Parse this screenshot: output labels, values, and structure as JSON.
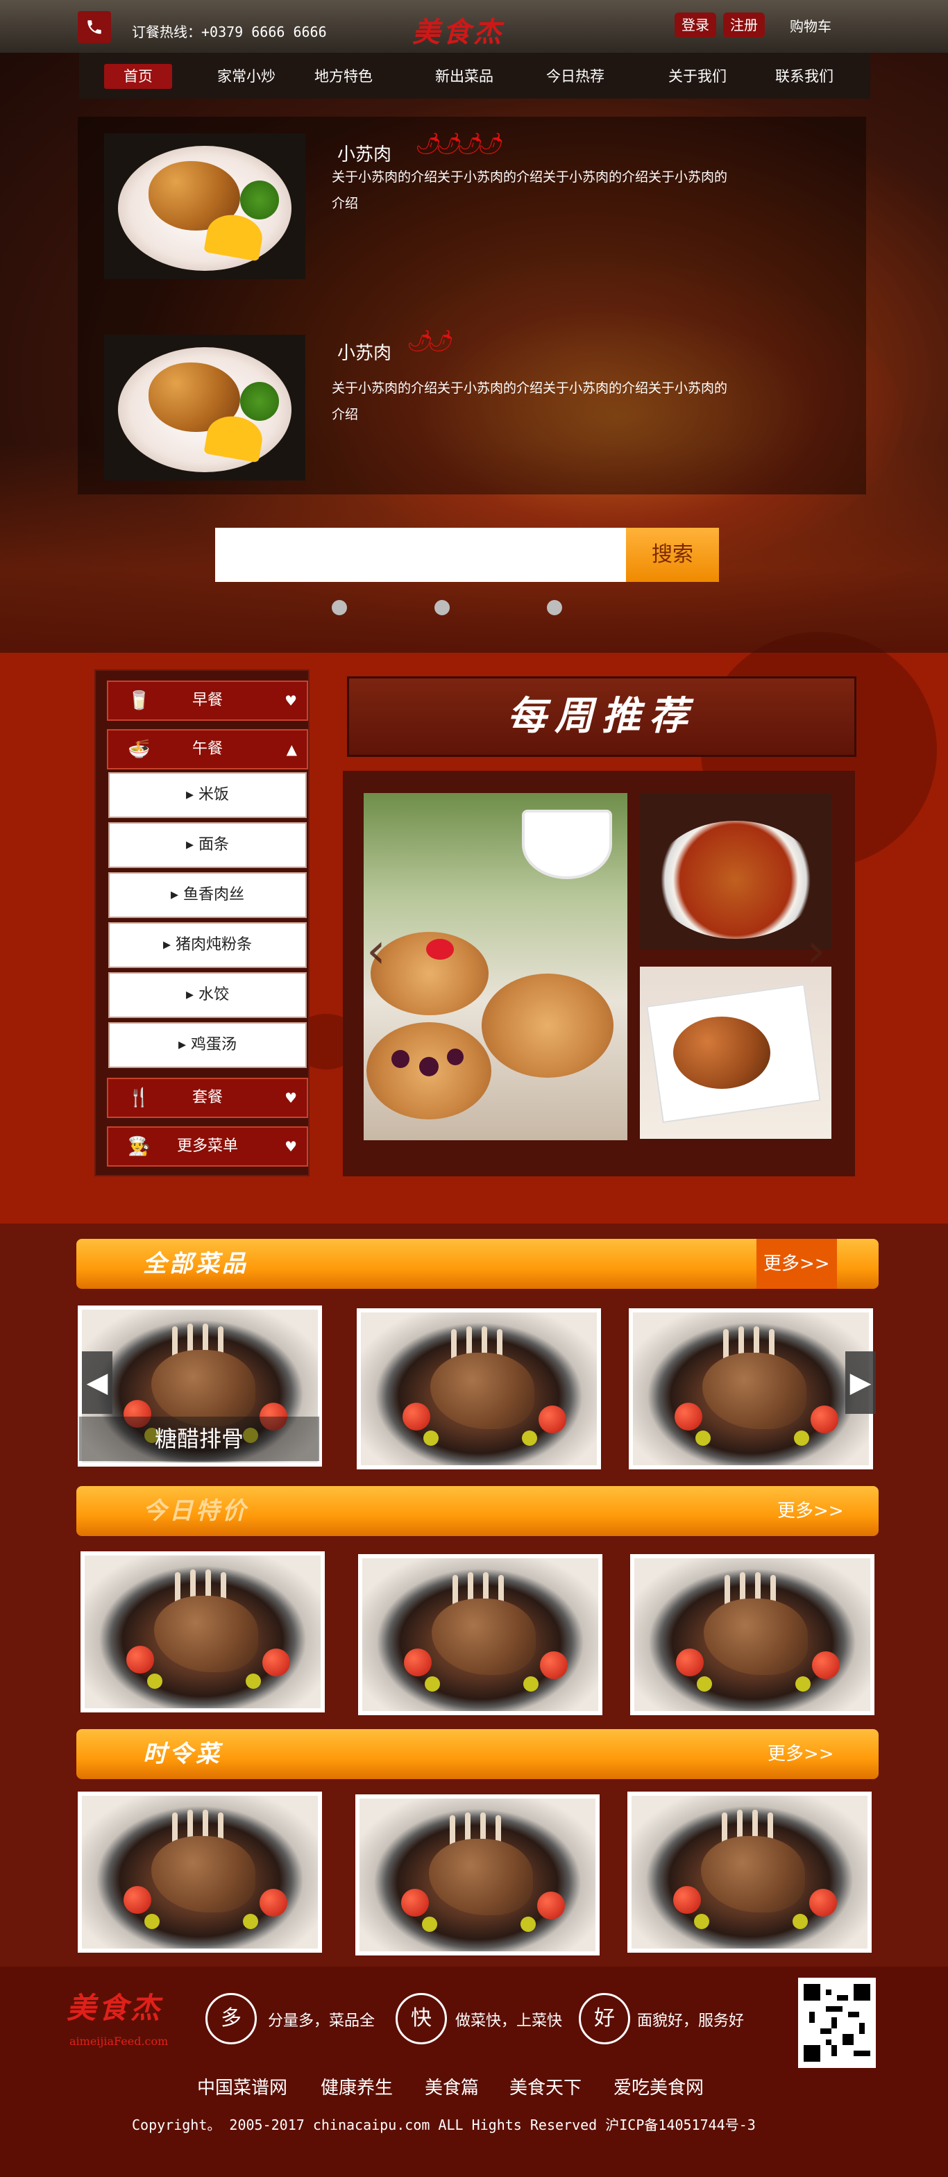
{
  "header": {
    "hotline": "订餐热线：+0379 6666 6666",
    "logo": "美食杰",
    "login": "登录",
    "register": "注册",
    "cart": "购物车"
  },
  "nav": [
    "首页",
    "家常小炒",
    "地方特色",
    "新出菜品",
    "今日热荐",
    "关于我们",
    "联系我们"
  ],
  "featured": [
    {
      "name": "小苏肉",
      "spice": "🌶🌶🌶🌶",
      "desc": "关于小苏肉的介绍关于小苏肉的介绍关于小苏肉的介绍关于小苏肉的介绍"
    },
    {
      "name": "小苏肉",
      "spice": "🌶🌶",
      "desc": "关于小苏肉的介绍关于小苏肉的介绍关于小苏肉的介绍关于小苏肉的介绍"
    }
  ],
  "search": {
    "button": "搜索",
    "placeholder": ""
  },
  "sidebar": {
    "cats": [
      "早餐",
      "午餐",
      "套餐",
      "更多菜单"
    ],
    "lunch_items": [
      "米饭",
      "面条",
      "鱼香肉丝",
      "猪肉炖粉条",
      "水饺",
      "鸡蛋汤"
    ]
  },
  "weekly": {
    "title": "每周推荐"
  },
  "sections": [
    {
      "title": "全部菜品",
      "more": "更多>>"
    },
    {
      "title": "今日特价",
      "more": "更多>>"
    },
    {
      "title": "时令菜",
      "more": "更多>>"
    }
  ],
  "card_caption": "糖醋排骨",
  "footer": {
    "logo": "美食杰",
    "logo_en": "aimeijiaFeed.com",
    "features": [
      {
        "icon": "多",
        "text": "分量多，菜品全"
      },
      {
        "icon": "快",
        "text": "做菜快，上菜快"
      },
      {
        "icon": "好",
        "text": "面貌好，服务好"
      }
    ],
    "links": [
      "中国菜谱网",
      "健康养生",
      "美食篇",
      "美食天下",
      "爱吃美食网"
    ],
    "copyright": "Copyright。 2005-2017 chinacaipu.com ALL Hights Reserved 沪ICP备14051744号-3"
  },
  "colors": {
    "brand_red": "#8a0e0e",
    "orange": "#ff9a0a",
    "dark_red": "#6a1608"
  }
}
